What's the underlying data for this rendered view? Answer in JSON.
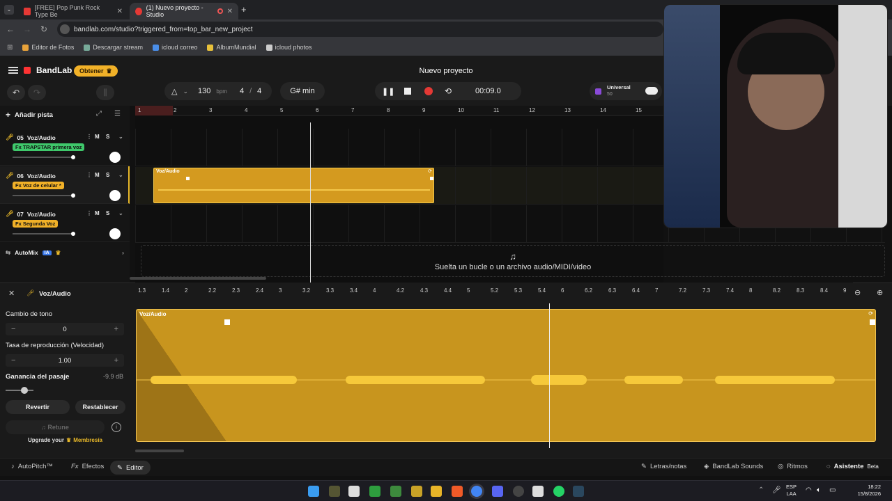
{
  "browser": {
    "tabs": [
      {
        "title": "[FREE] Pop Punk Rock Type Be"
      },
      {
        "title": "(1) Nuevo proyecto - Studio"
      }
    ],
    "new_tab": "+",
    "url": "bandlab.com/studio?triggered_from=top_bar_new_project",
    "bookmarks": [
      "Editor de Fotos",
      "Descargar stream",
      "icloud correo",
      "AlbumMundial",
      "icloud photos"
    ]
  },
  "header": {
    "brand": "BandLab",
    "obtener_label": "Obtener",
    "project_title": "Nuevo proyecto",
    "bpm_value": "130",
    "bpm_unit": "bpm",
    "time_sig_num": "4",
    "time_sig_sep": "/",
    "time_sig_den": "4",
    "key": "G# min",
    "time": "00:09.0",
    "universal_label": "Universal",
    "universal_value": "50"
  },
  "tracks_panel": {
    "add_track_label": "Añadir pista",
    "tracks": [
      {
        "number": "05",
        "name": "Voz/Audio",
        "fx": "TRAPSTAR primera voz",
        "m": "M",
        "s": "S"
      },
      {
        "number": "06",
        "name": "Voz/Audio",
        "fx": "Voz de celular *",
        "m": "M",
        "s": "S"
      },
      {
        "number": "07",
        "name": "Voz/Audio",
        "fx": "Segunda Voz",
        "m": "M",
        "s": "S"
      }
    ],
    "automix_label": "AutoMix",
    "automix_badge": "IA",
    "fx_prefix": "Fx"
  },
  "timeline": {
    "bars": [
      "1",
      "2",
      "3",
      "4",
      "5",
      "6",
      "7",
      "8",
      "9",
      "10",
      "11",
      "12",
      "13",
      "14",
      "15"
    ],
    "clip_name": "Voz/Audio",
    "drop_text": "Suelta un bucle o un archivo audio/MIDI/video"
  },
  "editor": {
    "track_name": "Voz/Audio",
    "cambio_label": "Cambio de tono",
    "cambio_value": "0",
    "tasa_label": "Tasa de reproducción (Velocidad)",
    "tasa_value": "1.00",
    "ganancia_label": "Ganancia del pasaje",
    "ganancia_value": "-9.9 dB",
    "revertir": "Revertir",
    "restablecer": "Restablecer",
    "retune": "Retune",
    "upgrade_text": "Upgrade your",
    "membership": "Membresía",
    "ruler": [
      "1.3",
      "1.4",
      "2",
      "2.2",
      "2.3",
      "2.4",
      "3",
      "3.2",
      "3.3",
      "3.4",
      "4",
      "4.2",
      "4.3",
      "4.4",
      "5",
      "5.2",
      "5.3",
      "5.4",
      "6",
      "6.2",
      "6.3",
      "6.4",
      "7",
      "7.2",
      "7.3",
      "7.4",
      "8",
      "8.2",
      "8.3",
      "8.4",
      "9"
    ],
    "clip_name": "Voz/Audio"
  },
  "bottom_bar": {
    "autopitch": "AutoPitch™",
    "fx": "Fx",
    "efectos": "Efectos",
    "editor": "Editor",
    "letras": "Letras/notas",
    "sounds": "BandLab Sounds",
    "ritmos": "Ritmos",
    "asistente": "Asistente",
    "beta": "Beta"
  },
  "taskbar": {
    "lang": "ESP",
    "region": "LAA",
    "time": "18:22",
    "date": "15/8/2026"
  },
  "colors": {
    "accent": "#e8b829",
    "clip": "#d49a1f",
    "record": "#e53935"
  }
}
